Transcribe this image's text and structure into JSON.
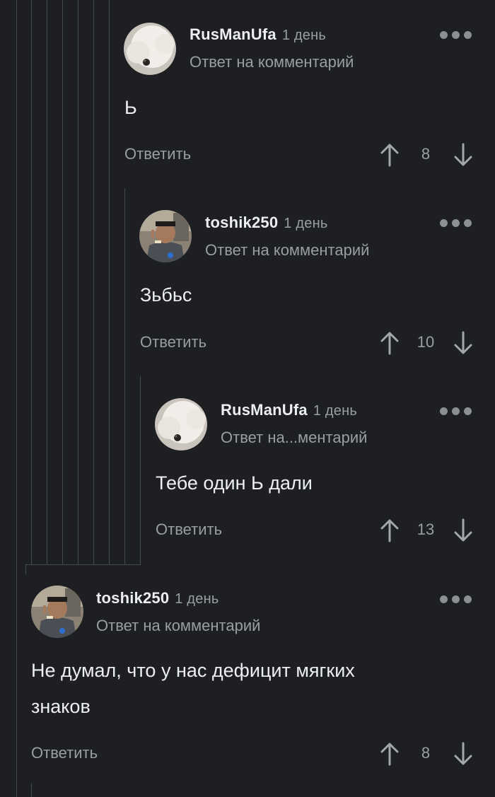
{
  "comments": [
    {
      "username": "RusManUfa",
      "time": "1 день",
      "reply_to": "Ответ на комментарий",
      "text": "Ь",
      "reply_label": "Ответить",
      "score": "8",
      "avatar": "white-fluffy-dog-avatar"
    },
    {
      "username": "toshik250",
      "time": "1 день",
      "reply_to": "Ответ на комментарий",
      "text": "Зьбьс",
      "reply_label": "Ответить",
      "score": "10",
      "avatar": "uniformed-man-avatar"
    },
    {
      "username": "RusManUfa",
      "time": "1 день",
      "reply_to": "Ответ на...ментарий",
      "text": "Тебе один Ь дали",
      "reply_label": "Ответить",
      "score": "13",
      "avatar": "white-fluffy-dog-avatar"
    },
    {
      "username": "toshik250",
      "time": "1 день",
      "reply_to": "Ответ на комментарий",
      "text_line1": "Не думал, что у нас дефицит мягких",
      "text_line2": "знаков",
      "reply_label": "Ответить",
      "score": "8",
      "avatar": "uniformed-man-avatar"
    }
  ],
  "colors": {
    "background": "#1d1f22",
    "text": "#eceef0",
    "muted": "#9a9ea3",
    "thread_line": "#46494d"
  }
}
